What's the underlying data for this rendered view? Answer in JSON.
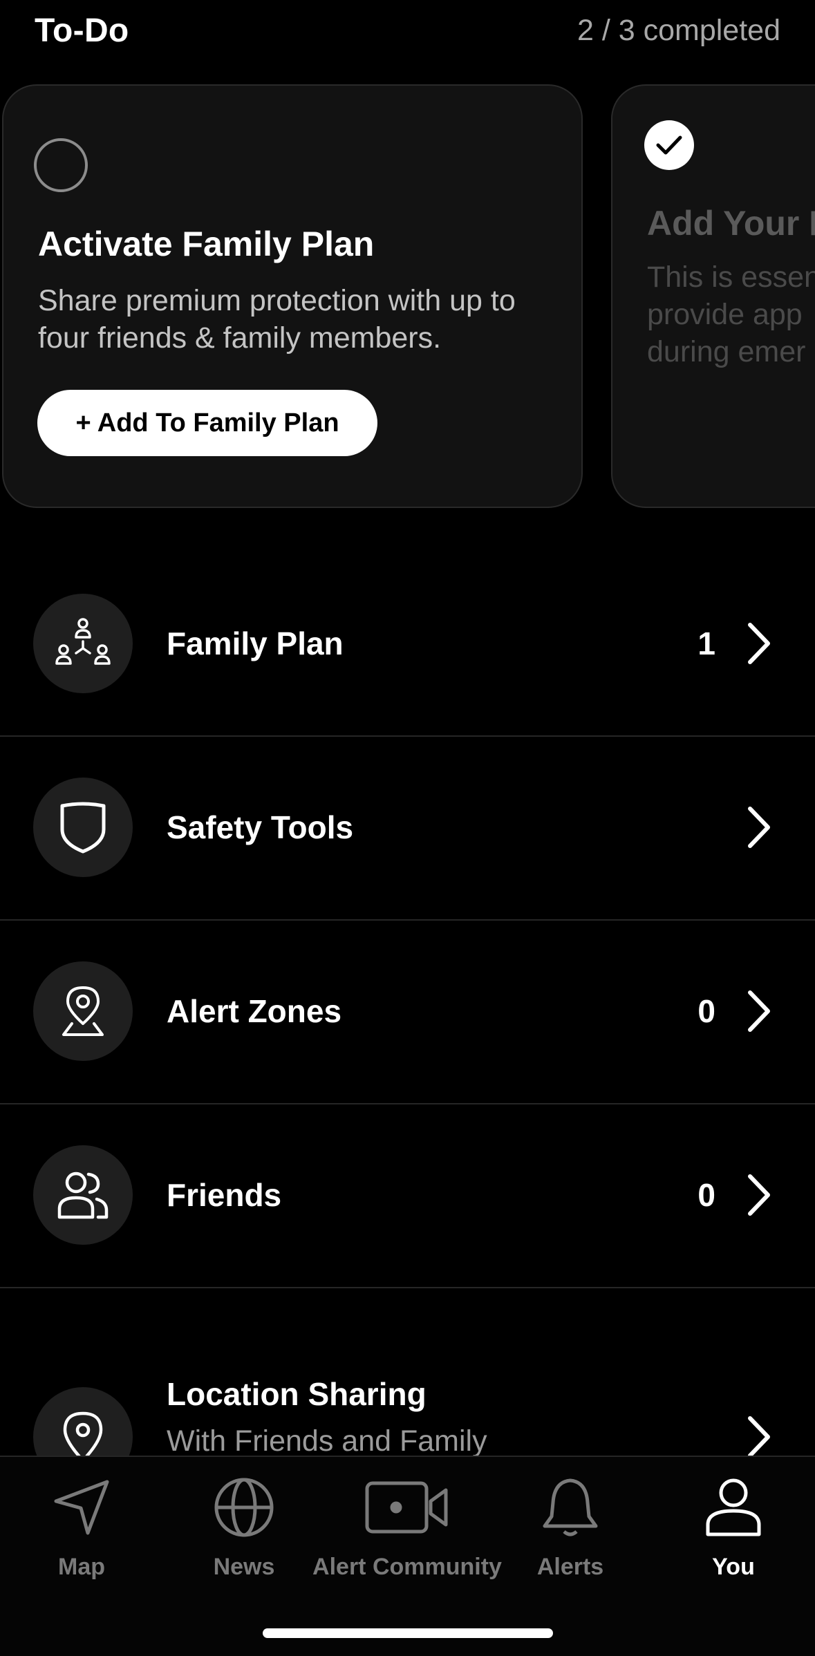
{
  "todo": {
    "title": "To-Do",
    "progress": "2 / 3 completed",
    "cards": [
      {
        "title": "Activate Family Plan",
        "description": "Share premium protection with up to four friends & family members.",
        "button_label": "+ Add To Family Plan",
        "completed": false
      },
      {
        "title": "Add Your F",
        "description_lines": [
          "This is essen",
          "provide app",
          "during emer"
        ],
        "completed": true
      }
    ]
  },
  "menu": {
    "items": [
      {
        "label": "Family Plan",
        "count": "1",
        "icon": "family-plan-icon"
      },
      {
        "label": "Safety Tools",
        "count": "",
        "icon": "shield-icon"
      },
      {
        "label": "Alert Zones",
        "count": "0",
        "icon": "location-zone-icon"
      },
      {
        "label": "Friends",
        "count": "0",
        "icon": "friends-icon"
      },
      {
        "label": "Location Sharing",
        "subtitle": "With Friends and Family Plan Members",
        "count": "",
        "icon": "location-pin-icon"
      }
    ]
  },
  "tabbar": {
    "tabs": [
      {
        "label": "Map",
        "icon": "navigation-arrow-icon",
        "active": false
      },
      {
        "label": "News",
        "icon": "globe-icon",
        "active": false
      },
      {
        "label": "Alert Community",
        "icon": "video-camera-icon",
        "active": false
      },
      {
        "label": "Alerts",
        "icon": "bell-icon",
        "active": false
      },
      {
        "label": "You",
        "icon": "person-icon",
        "active": true
      }
    ]
  },
  "colors": {
    "background": "#000000",
    "card": "#121212",
    "icon_circle": "#1f1f1f",
    "muted_text": "#9b9b9b",
    "inactive_tab": "#7a7a7a"
  }
}
